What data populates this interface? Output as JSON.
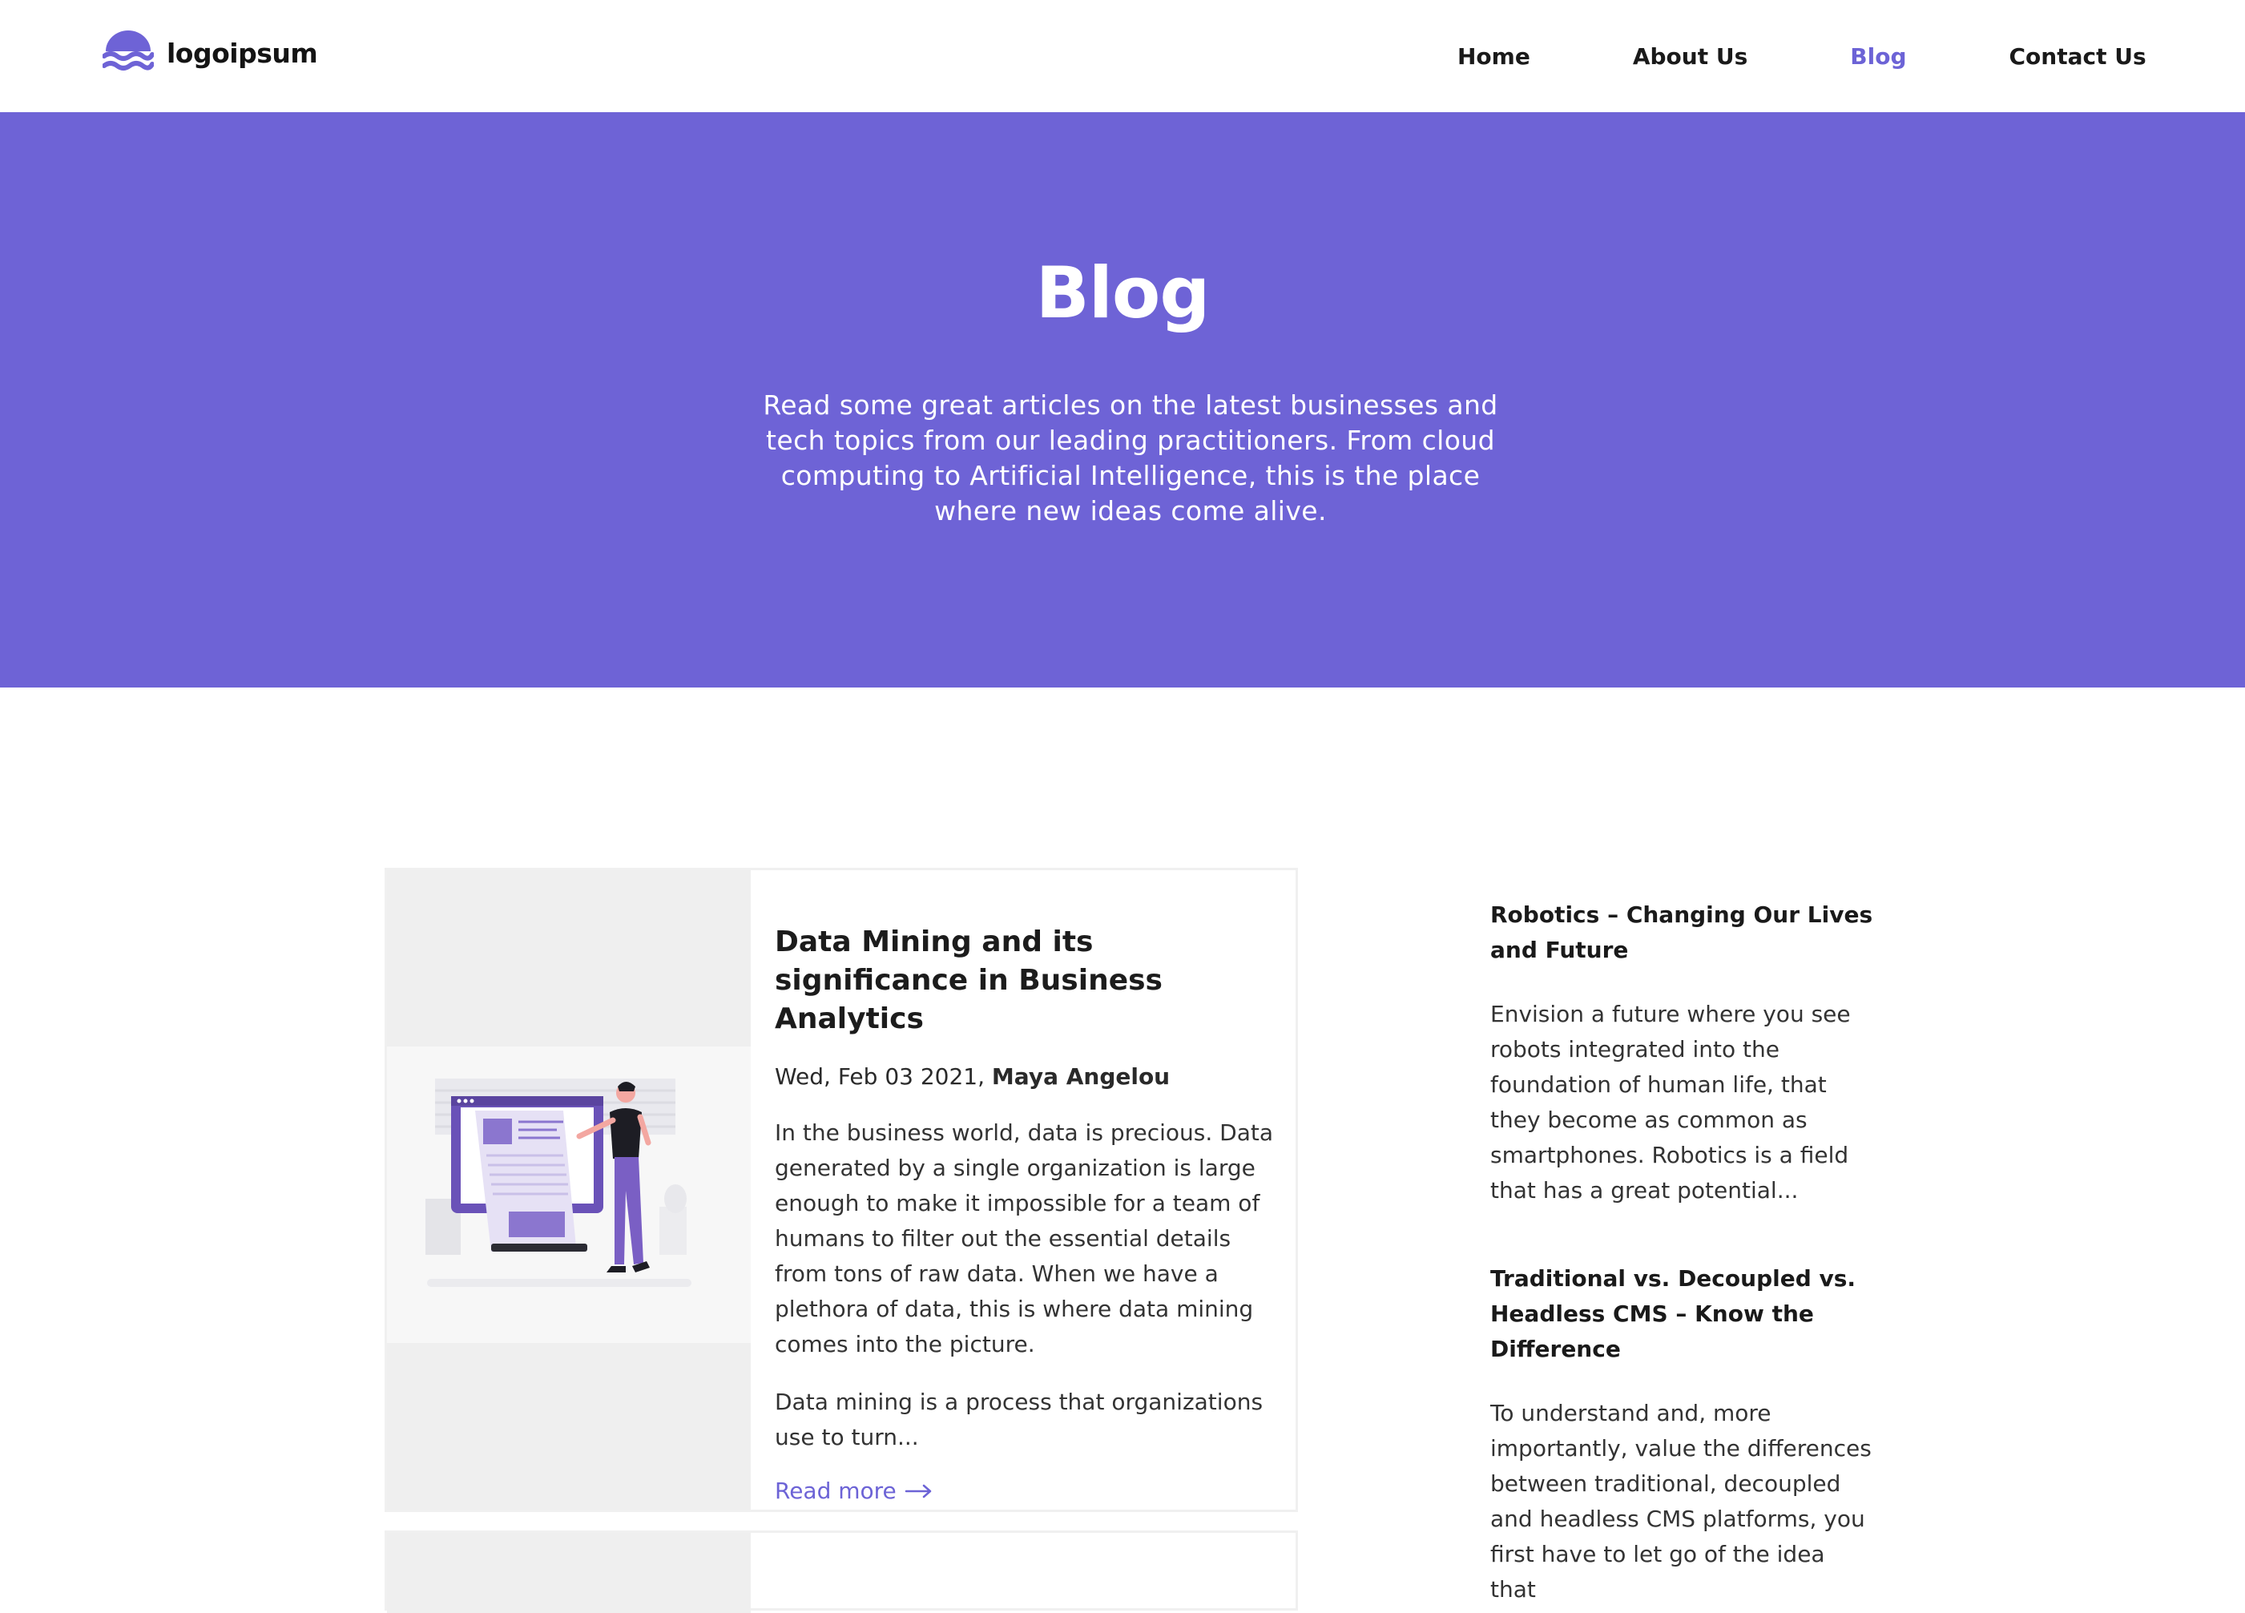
{
  "brand": {
    "name": "logoipsum",
    "color": "#6e63d6"
  },
  "nav": {
    "items": [
      {
        "label": "Home"
      },
      {
        "label": "About Us"
      },
      {
        "label": "Blog",
        "active": true
      },
      {
        "label": "Contact Us"
      }
    ]
  },
  "hero": {
    "title": "Blog",
    "description": "Read some great articles on the latest businesses and tech topics from our leading practitioners. From cloud computing to Artificial Intelligence, this is the place where new ideas come alive."
  },
  "featured_post": {
    "title": "Data Mining and its significance in Business Analytics",
    "date": "Wed, Feb 03 2021,",
    "author": "Maya Angelou",
    "paragraphs": [
      "In the business world, data is precious. Data generated by a single organization is large enough to make it impossible for a team of humans to filter out the essential details from tons of raw data. When we have a plethora of data, this is where data mining comes into the picture.",
      "Data mining is a process that organizations use to turn..."
    ],
    "read_more_label": "Read more",
    "image_icon": "data-analysis-illustration"
  },
  "sidebar": {
    "posts": [
      {
        "title": "Robotics – Changing Our Lives and Future",
        "excerpt": "Envision a future where you see robots integrated into the foundation of human life, that they become as common as smartphones. Robotics is a field that has a great potential..."
      },
      {
        "title": "Traditional vs. Decoupled vs. Headless CMS – Know the Difference",
        "excerpt": "To understand and, more importantly, value the differences between traditional, decoupled and headless CMS platforms, you first have to let go of the idea that"
      }
    ]
  },
  "colors": {
    "accent": "#6c63d6",
    "hero_bg": "#6e63d6",
    "text": "#1c1c1c",
    "card_border": "#f0f0f0"
  }
}
